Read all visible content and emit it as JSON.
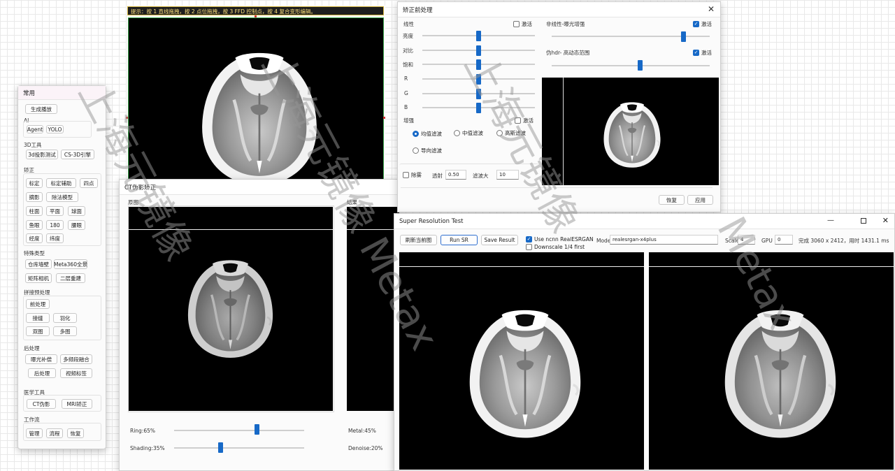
{
  "editor": {
    "hint": "提示：按 1 直线拖拽，按 2 点位拖拽，按 3 FFD 控制点，按 4 复合变形编辑。"
  },
  "panel": {
    "title": "常用",
    "gen_play": "生成播放",
    "ai": {
      "title": "AI",
      "items": [
        "Agent",
        "YOLO"
      ]
    },
    "tools3d": {
      "title": "3D工具",
      "items": [
        "3d投影测试",
        "CS-3D引擎"
      ]
    },
    "correct": {
      "title": "矫正",
      "items": [
        "标定",
        "标定辅助",
        "四点",
        "摘影",
        "除法模型",
        "柱面",
        "平面",
        "球面",
        "鱼眼",
        "180",
        "腰眼",
        "经度",
        "纬度"
      ]
    },
    "special": {
      "title": "特殊类型",
      "items": [
        "仓库墙壁",
        "Meta360全景",
        "矩阵相机",
        "二层重建"
      ]
    },
    "stitch": {
      "title": "拼接预处理",
      "items": [
        "前处理",
        "接缝",
        "羽化",
        "双图",
        "多图"
      ]
    },
    "post": {
      "title": "后处理",
      "items": [
        "曝光补偿",
        "多频段融合",
        "后处理",
        "视频标签"
      ]
    },
    "medical": {
      "title": "医学工具",
      "items": [
        "CT伪影",
        "MRI矫正"
      ]
    },
    "workflow": {
      "title": "工作流",
      "items": [
        "管理",
        "流程",
        "恢复"
      ]
    }
  },
  "ct": {
    "title": "CT伪影矫正",
    "original": "原图",
    "result": "结果",
    "ring_label": "Ring:65%",
    "ring_value": 0.65,
    "shading_label": "Shading:35%",
    "shading_value": 0.35,
    "metal_label": "Metal:45%",
    "denoise_label": "Denoise:20%"
  },
  "pre": {
    "title": "矫正前处理",
    "linear": "线性",
    "activate": "激活",
    "sliders": [
      {
        "label": "亮度",
        "value": 0.5
      },
      {
        "label": "对比",
        "value": 0.5
      },
      {
        "label": "饱和",
        "value": 0.5
      },
      {
        "label": "R",
        "value": 0.5
      },
      {
        "label": "G",
        "value": 0.5
      },
      {
        "label": "B",
        "value": 0.5
      }
    ],
    "nonlinear": "非线性-曝光增强",
    "nonlinear_value": 0.87,
    "hdr": "伪hdr- 高动态范围",
    "hdr_value": 0.52,
    "enhance": "增强",
    "filters": [
      "均值滤波",
      "中值滤波",
      "高斯滤波",
      "导向滤波"
    ],
    "dehaze": "除雾",
    "transmit_label": "透射",
    "transmit_value": "0.50",
    "filter_size_label": "滤波大",
    "filter_size_value": "10",
    "restore": "恢复",
    "apply": "应用"
  },
  "sr": {
    "title": "Super Resolution Test",
    "refresh": "刷新当前图",
    "run": "Run SR",
    "save": "Save Result",
    "use_ncnn": "Use ncnn RealESRGAN",
    "downscale": "Downscale 1/4 first",
    "model_label": "Model",
    "model_value": "realesrgan-x4plus",
    "scale_label": "Scale",
    "scale_value": "4",
    "gpu_label": "GPU",
    "gpu_value": "0",
    "status": "完成 3060 x 2412，用时 1431.1 ms"
  }
}
